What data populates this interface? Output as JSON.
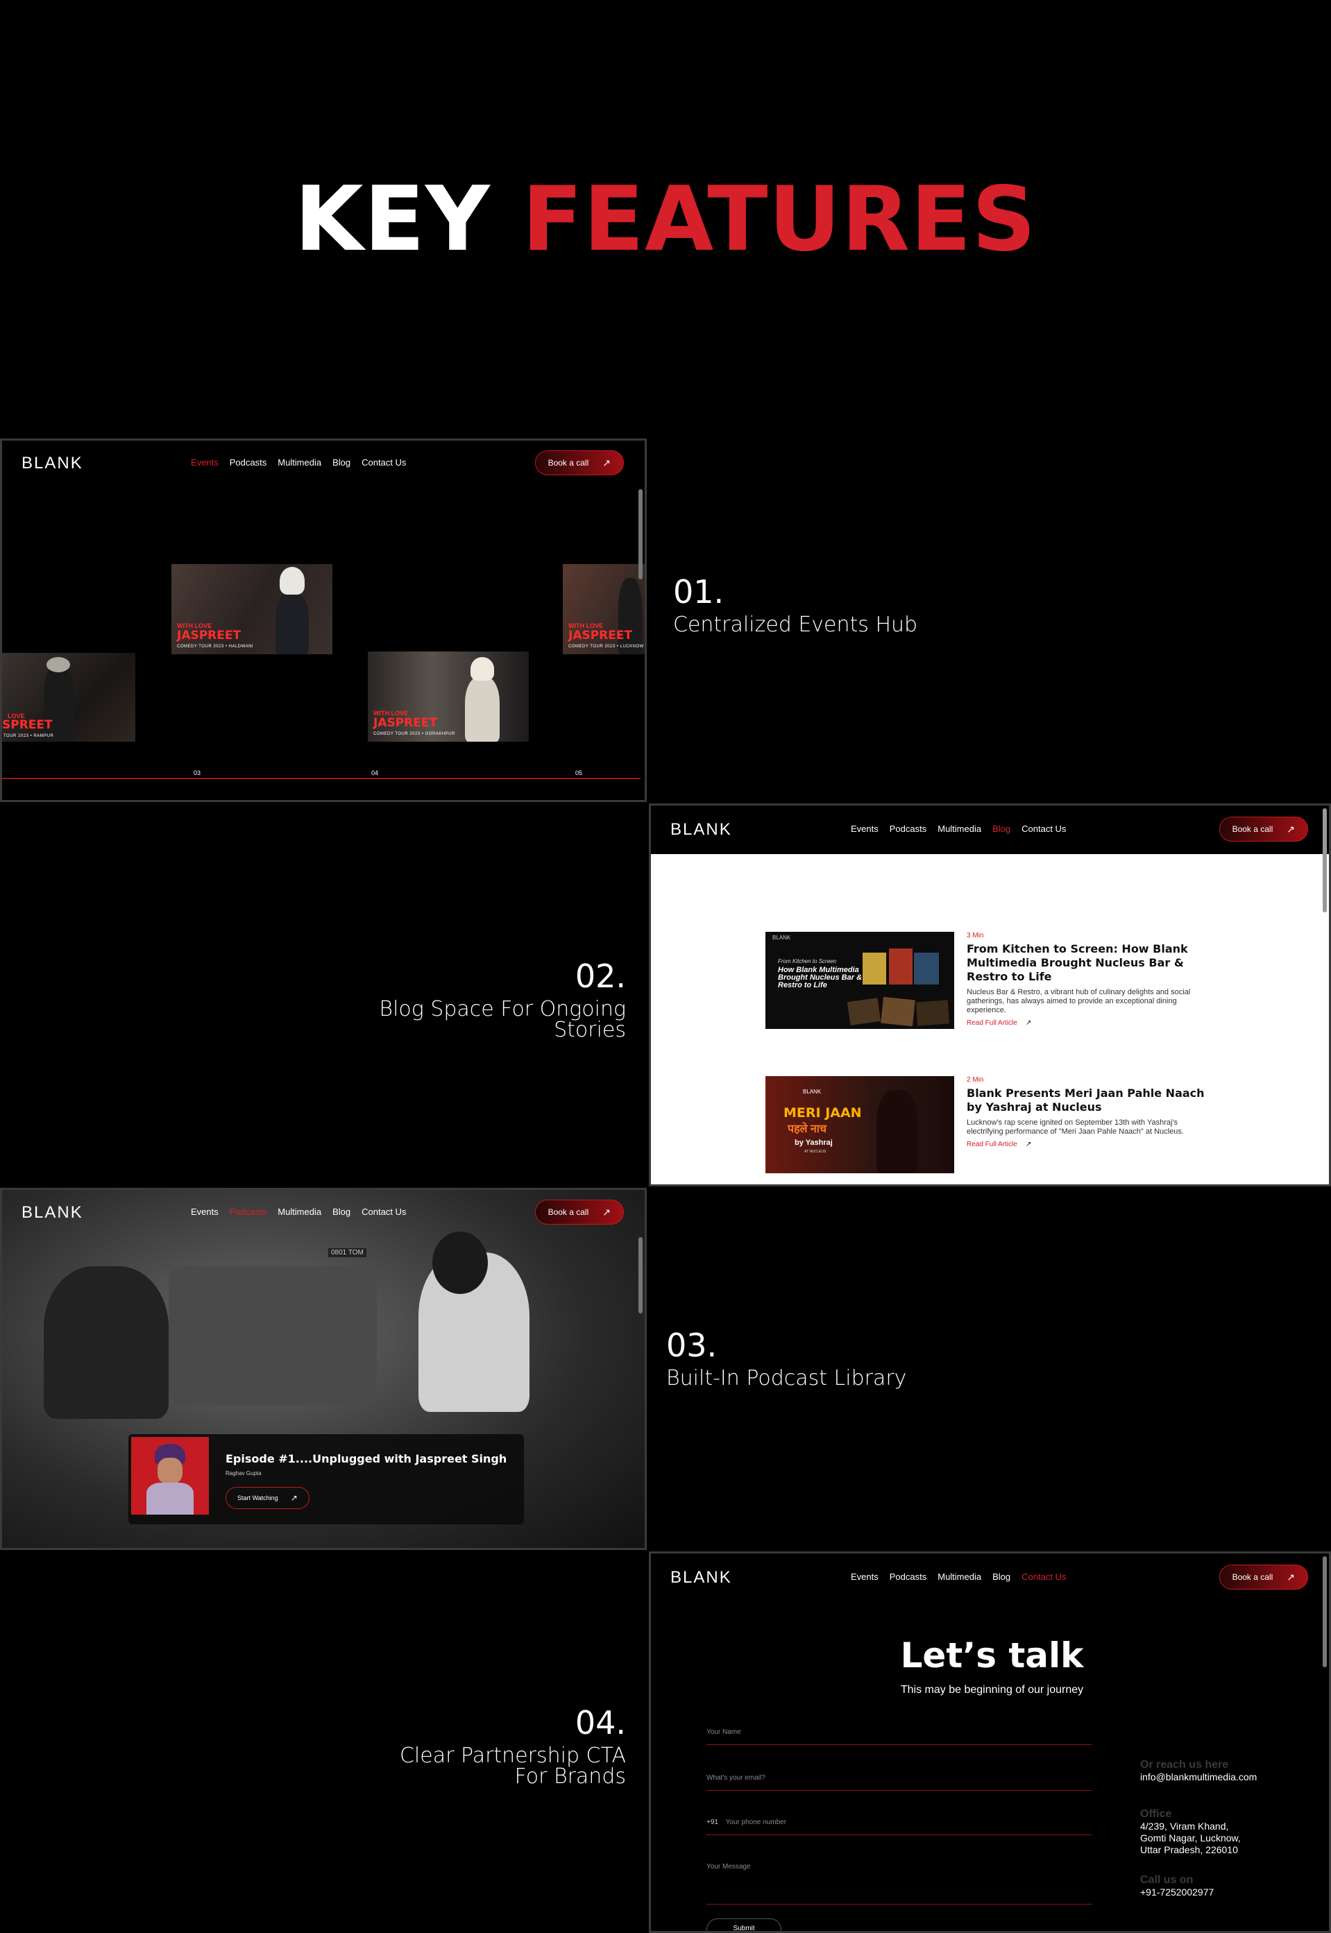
{
  "hero": {
    "word1": "KEY",
    "word2": "FEATURES"
  },
  "nav": {
    "logo": "BLANK",
    "links": [
      "Events",
      "Podcasts",
      "Multimedia",
      "Blog",
      "Contact Us"
    ],
    "book_label": "Book a call"
  },
  "features": [
    {
      "num": "01.",
      "title": "Centralized Events Hub"
    },
    {
      "num": "02.",
      "title_line1": "Blog Space For Ongoing",
      "title_line2": "Stories"
    },
    {
      "num": "03.",
      "title": "Built-In Podcast Library"
    },
    {
      "num": "04.",
      "title_line1": "Clear Partnership CTA",
      "title_line2": "For Brands"
    }
  ],
  "events": {
    "cap_top": "WITH LOVE",
    "cap_name": "JASPREET",
    "thumbs": [
      {
        "cap_name": "SPREET",
        "cap_top": "LOVE",
        "tour": "TOUR 2023 • RAMPUR"
      },
      {
        "tour": "COMEDY TOUR 2023 • HALDWANI"
      },
      {
        "tour": "COMEDY TOUR 2023 • GORAKHPUR"
      },
      {
        "tour": "COMEDY TOUR 2023 • LUCKNOW"
      }
    ],
    "indices": [
      "03",
      "04",
      "05"
    ]
  },
  "blog": {
    "posts": [
      {
        "min": "3 Min",
        "title": "From Kitchen to Screen: How Blank Multimedia Brought Nucleus Bar & Restro to Life",
        "desc": "Nucleus Bar & Restro, a vibrant hub of culinary delights and social gatherings, has always aimed to provide an exceptional dining experience.",
        "read": "Read Full Article",
        "img_small": "From Kitchen to Screen",
        "img_big": "How Blank Multimedia Brought Nucleus Bar & Restro to Life",
        "img_logo": "BLANK"
      },
      {
        "min": "2 Min",
        "title": "Blank Presents Meri Jaan Pahle Naach by Yashraj at Nucleus",
        "desc": "Lucknow's rap scene ignited on September 13th with Yashraj's electrifying performance of \"Meri Jaan Pahle Naach\" at Nucleus.",
        "read": "Read Full Article",
        "img_title1": "MERI JAAN",
        "img_title2": "पहले नाच",
        "img_by": "by Yashraj",
        "img_at": "AT NUCLEUS",
        "img_logo": "BLANK"
      }
    ]
  },
  "podcast": {
    "title": "Episode #1....Unplugged with Jaspreet Singh",
    "guest": "Raghav Gupta",
    "cta": "Start Watching",
    "plate": "0801 TOM"
  },
  "contact": {
    "heading": "Let’s talk",
    "sub": "This may be beginning of our journey",
    "name_ph": "Your Name",
    "email_ph": "What's your email?",
    "phone_code": "+91",
    "phone_ph": "Your phone number",
    "msg_ph": "Your Message",
    "submit": "Submit",
    "reach_label": "Or reach us here",
    "email": "info@blankmultimedia.com",
    "office_label": "Office",
    "office_lines": [
      "4/239, Viram Khand,",
      "Gomti Nagar, Lucknow,",
      "Uttar Pradesh, 226010"
    ],
    "call_label": "Call us on",
    "phone": "+91-7252002977"
  },
  "colors": {
    "accent": "#d6202a",
    "bg": "#000000",
    "border": "#3a3a3a"
  }
}
